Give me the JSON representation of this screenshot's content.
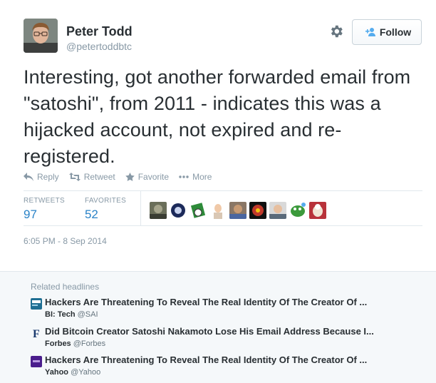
{
  "user": {
    "name": "Peter Todd",
    "handle": "@petertoddbtc"
  },
  "follow_button": {
    "label": "Follow"
  },
  "tweet": {
    "text": "Interesting, got another forwarded email from \"satoshi\", from 2011 - indicates this was a hijacked account, not expired and re-registered."
  },
  "actions": {
    "reply": "Reply",
    "retweet": "Retweet",
    "favorite": "Favorite",
    "more": "More"
  },
  "stats": {
    "retweets_label": "RETWEETS",
    "retweets_value": "97",
    "favorites_label": "FAVORITES",
    "favorites_value": "52"
  },
  "timestamp": "6:05 PM - 8 Sep 2014",
  "related": {
    "title": "Related headlines",
    "items": [
      {
        "headline": "Hackers Are Threatening To Reveal The Real Identity Of The Creator Of ...",
        "source": "BI: Tech",
        "handle": "@SAI",
        "icon": "bi-tech-logo"
      },
      {
        "headline": "Did Bitcoin Creator Satoshi Nakamoto Lose His Email Address Because I...",
        "source": "Forbes",
        "handle": "@Forbes",
        "icon": "forbes-logo"
      },
      {
        "headline": "Hackers Are Threatening To Reveal The Real Identity Of The Creator Of ...",
        "source": "Yahoo",
        "handle": "@Yahoo",
        "icon": "yahoo-logo"
      }
    ]
  },
  "colors": {
    "link_blue": "#2a83c8",
    "muted": "#8899a6",
    "text": "#292f33",
    "panel_bg": "#f5f8fa"
  }
}
